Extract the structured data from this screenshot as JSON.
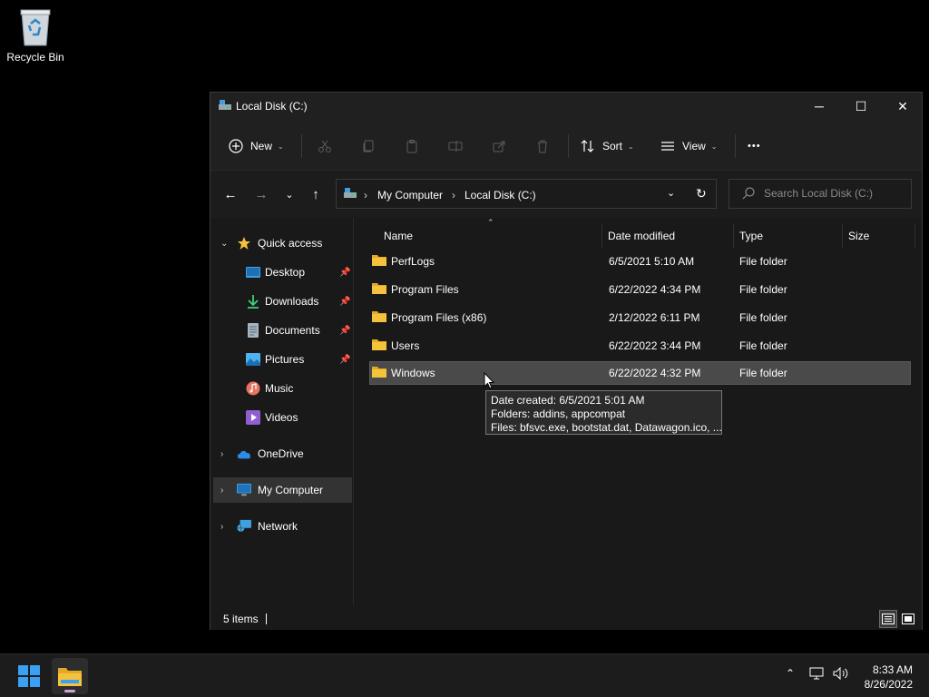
{
  "desktop": {
    "recycle_bin_label": "Recycle Bin"
  },
  "window": {
    "title": "Local Disk (C:)",
    "controls": {
      "minimize": "─",
      "maximize": "☐",
      "close": "✕"
    }
  },
  "toolbar": {
    "new_label": "New",
    "sort_label": "Sort",
    "view_label": "View",
    "more_label": "•••"
  },
  "address": {
    "crumbs": [
      "My Computer",
      "Local Disk (C:)"
    ],
    "search_placeholder": "Search Local Disk (C:)"
  },
  "nav": {
    "quick_access": "Quick access",
    "items": [
      {
        "label": "Desktop",
        "pinned": true
      },
      {
        "label": "Downloads",
        "pinned": true
      },
      {
        "label": "Documents",
        "pinned": true
      },
      {
        "label": "Pictures",
        "pinned": true
      },
      {
        "label": "Music",
        "pinned": false
      },
      {
        "label": "Videos",
        "pinned": false
      }
    ],
    "onedrive": "OneDrive",
    "my_computer": "My Computer",
    "network": "Network"
  },
  "columns": {
    "name": "Name",
    "date": "Date modified",
    "type": "Type",
    "size": "Size"
  },
  "files": [
    {
      "name": "PerfLogs",
      "date": "6/5/2021 5:10 AM",
      "type": "File folder"
    },
    {
      "name": "Program Files",
      "date": "6/22/2022 4:34 PM",
      "type": "File folder"
    },
    {
      "name": "Program Files (x86)",
      "date": "2/12/2022 6:11 PM",
      "type": "File folder"
    },
    {
      "name": "Users",
      "date": "6/22/2022 3:44 PM",
      "type": "File folder"
    },
    {
      "name": "Windows",
      "date": "6/22/2022 4:32 PM",
      "type": "File folder"
    }
  ],
  "tooltip": {
    "line1": "Date created: 6/5/2021 5:01 AM",
    "line2": "Folders: addins, appcompat",
    "line3": "Files: bfsvc.exe, bootstat.dat, Datawagon.ico, ..."
  },
  "status": {
    "count": "5 items"
  },
  "taskbar": {
    "time": "8:33 AM",
    "date": "8/26/2022"
  },
  "colors": {
    "folder": "#f5c33b",
    "accent": "#0078d4",
    "selected_row": "#4a4a4a"
  }
}
